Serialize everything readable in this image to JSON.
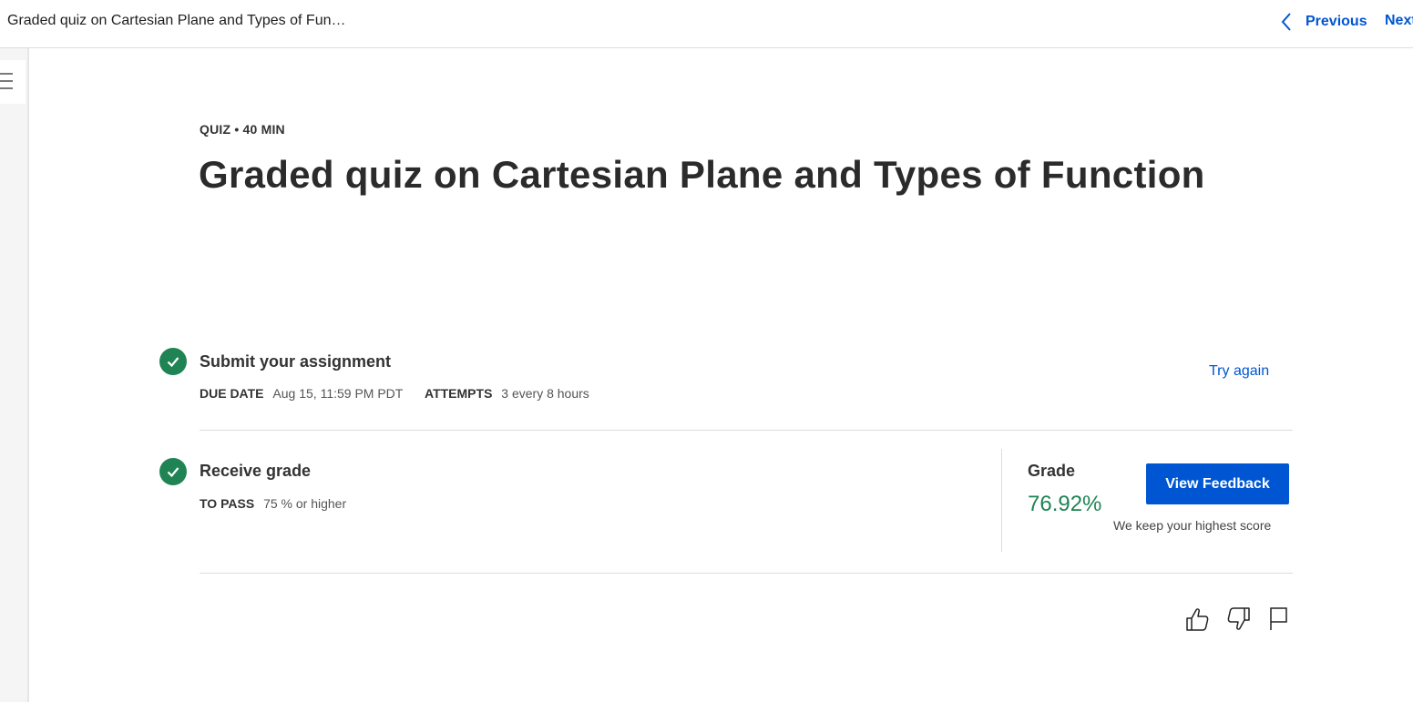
{
  "header": {
    "title": "Graded quiz on Cartesian Plane and Types of Fun…",
    "previous_label": "Previous",
    "next_label": "Next"
  },
  "quiz": {
    "eyebrow": "QUIZ • 40 MIN",
    "title": "Graded quiz on Cartesian Plane and Types of Function"
  },
  "submit_step": {
    "title": "Submit your assignment",
    "due_date_label": "DUE DATE",
    "due_date_value": "Aug 15, 11:59 PM PDT",
    "attempts_label": "ATTEMPTS",
    "attempts_value": "3 every 8 hours",
    "try_again_label": "Try again"
  },
  "grade_step": {
    "title": "Receive grade",
    "to_pass_label": "TO PASS",
    "to_pass_value": "75 % or higher",
    "grade_label": "Grade",
    "grade_value": "76.92%",
    "view_feedback_label": "View Feedback",
    "highest_score_note": "We keep your highest score"
  },
  "colors": {
    "accent": "#0056d2",
    "success": "#1f8354"
  },
  "icons": {
    "menu": "hamburger-icon",
    "previous": "chevron-left-icon",
    "check": "check-icon",
    "like": "thumbs-up-icon",
    "dislike": "thumbs-down-icon",
    "report": "flag-icon"
  }
}
